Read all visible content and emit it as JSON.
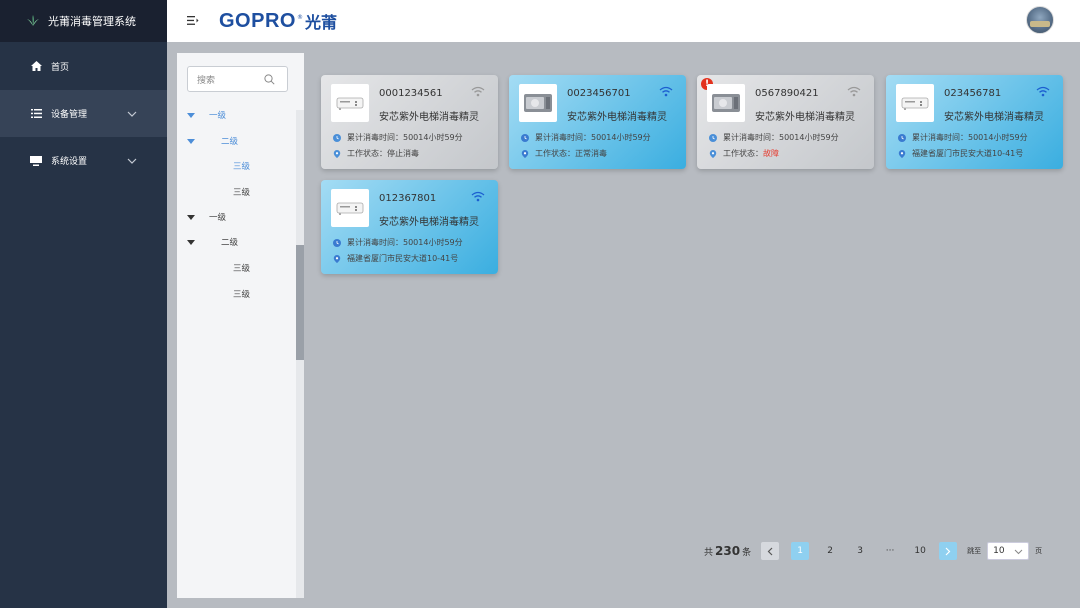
{
  "app": {
    "title": "光莆消毒管理系统"
  },
  "sidebar": {
    "items": [
      {
        "label": "首页",
        "icon": "home-icon"
      },
      {
        "label": "设备管理",
        "icon": "list-icon"
      },
      {
        "label": "系统设置",
        "icon": "monitor-icon"
      }
    ]
  },
  "header": {
    "brand_en": "GOPRO",
    "brand_reg": "®",
    "brand_cn": "光莆"
  },
  "tree": {
    "search_placeholder": "搜索",
    "nodes": [
      {
        "label": "一级"
      },
      {
        "label": "二级"
      },
      {
        "label": "三级"
      },
      {
        "label": "三级"
      },
      {
        "label": "一级"
      },
      {
        "label": "二级"
      },
      {
        "label": "三级"
      },
      {
        "label": "三级"
      }
    ]
  },
  "cards": [
    {
      "id": "0001234561",
      "name": "安芯紫外电梯消毒精灵",
      "line1": "累计消毒时间：50014小时59分",
      "line2_label": "工作状态：",
      "line2_value": "停止消毒"
    },
    {
      "id": "0023456701",
      "name": "安芯紫外电梯消毒精灵",
      "line1": "累计消毒时间：50014小时59分",
      "line2_label": "工作状态：",
      "line2_value": "正常消毒"
    },
    {
      "id": "0567890421",
      "name": "安芯紫外电梯消毒精灵",
      "line1": "累计消毒时间：50014小时59分",
      "line2_label": "工作状态：",
      "line2_value": "故障"
    },
    {
      "id": "023456781",
      "name": "安芯紫外电梯消毒精灵",
      "line1": "累计消毒时间：50014小时59分",
      "line2_label": "",
      "line2_value": "福建省厦门市民安大道10-41号"
    },
    {
      "id": "012367801",
      "name": "安芯紫外电梯消毒精灵",
      "line1": "累计消毒时间：50014小时59分",
      "line2_label": "",
      "line2_value": "福建省厦门市民安大道10-41号"
    }
  ],
  "pager": {
    "prefix": "共",
    "total": "230",
    "suffix": "条",
    "pages": [
      "1",
      "2",
      "3",
      "···",
      "10"
    ],
    "goto_label": "跳至",
    "page_size": "10",
    "unit": "页"
  },
  "colors": {
    "sidebar": "#263346",
    "brand": "#1e4fa0",
    "active": "#8fd0f0",
    "fault": "#e63a2e"
  }
}
